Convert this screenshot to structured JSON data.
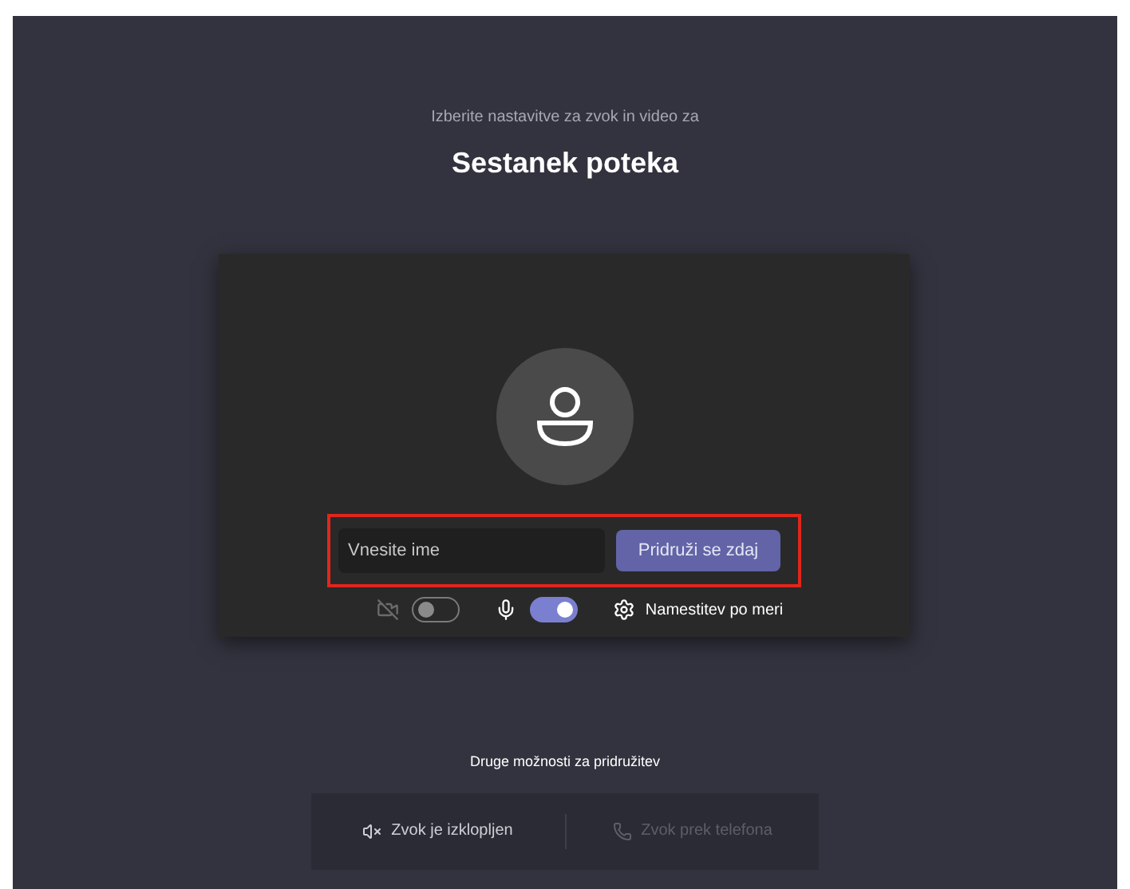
{
  "subtitle": "Izberite nastavitve za zvok in video za",
  "title": "Sestanek poteka",
  "name_field": {
    "placeholder": "Vnesite ime"
  },
  "join_button": "Pridruži se zdaj",
  "highlight": true,
  "toggles": [
    {
      "kind": "camera",
      "on": false
    },
    {
      "kind": "mic",
      "on": true
    }
  ],
  "settings_link": "Namestitev po meri",
  "other_options_title": "Druge možnosti za pridružitev",
  "other_options": [
    {
      "kind": "audio-off",
      "label": "Zvok je izklopljen",
      "disabled": false
    },
    {
      "kind": "phone",
      "label": "Zvok prek telefona",
      "disabled": true
    }
  ]
}
